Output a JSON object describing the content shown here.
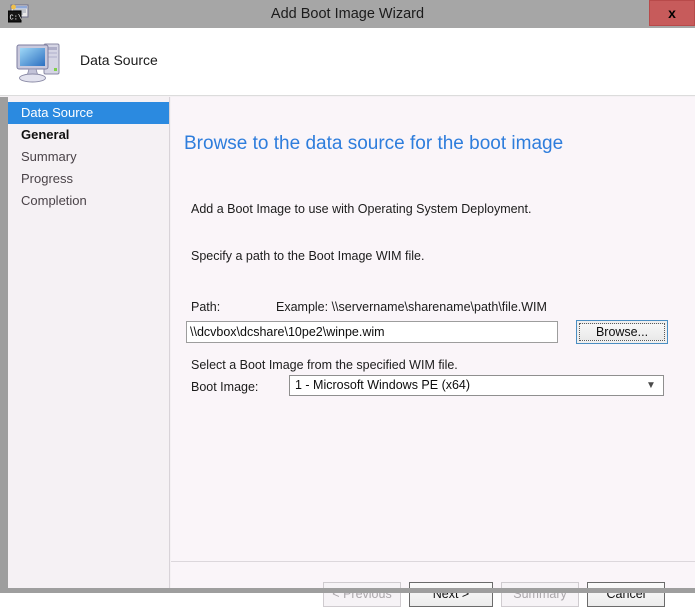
{
  "window": {
    "title": "Add Boot Image Wizard",
    "app_icon": "console-window-icon",
    "close_label": "x"
  },
  "header": {
    "icon": "computer-icon",
    "title": "Data Source"
  },
  "sidebar": {
    "items": [
      {
        "label": "Data Source",
        "state": "selected"
      },
      {
        "label": "General",
        "state": "next"
      },
      {
        "label": "Summary",
        "state": "normal"
      },
      {
        "label": "Progress",
        "state": "normal"
      },
      {
        "label": "Completion",
        "state": "normal"
      }
    ]
  },
  "main": {
    "heading": "Browse to the data source for the boot image",
    "intro_1": "Add a Boot Image to use with Operating System Deployment.",
    "intro_2": "Specify a path to the Boot Image WIM file.",
    "path_label": "Path:",
    "path_example": "Example: \\\\servername\\sharename\\path\\file.WIM",
    "path_value": "\\\\dcvbox\\dcshare\\10pe2\\winpe.wim",
    "path_placeholder": "",
    "browse_label": "Browse...",
    "select_note": "Select a Boot Image from the specified WIM file.",
    "boot_image_label": "Boot Image:",
    "boot_image_value": "1 - Microsoft Windows PE (x64)",
    "boot_image_options": [
      "1 - Microsoft Windows PE (x64)"
    ],
    "dropdown_icon": "chevron-down-icon"
  },
  "footer": {
    "previous_label": "< Previous",
    "next_label": "Next >",
    "summary_label": "Summary",
    "cancel_label": "Cancel"
  },
  "colors": {
    "titlebar": "#a6a6a6",
    "close_button": "#c75b5b",
    "accent_heading": "#2e7ddc",
    "selection": "#2b8ae0",
    "panel_bg": "#faf5f9",
    "sidebar_bg": "#f5f1f4"
  }
}
